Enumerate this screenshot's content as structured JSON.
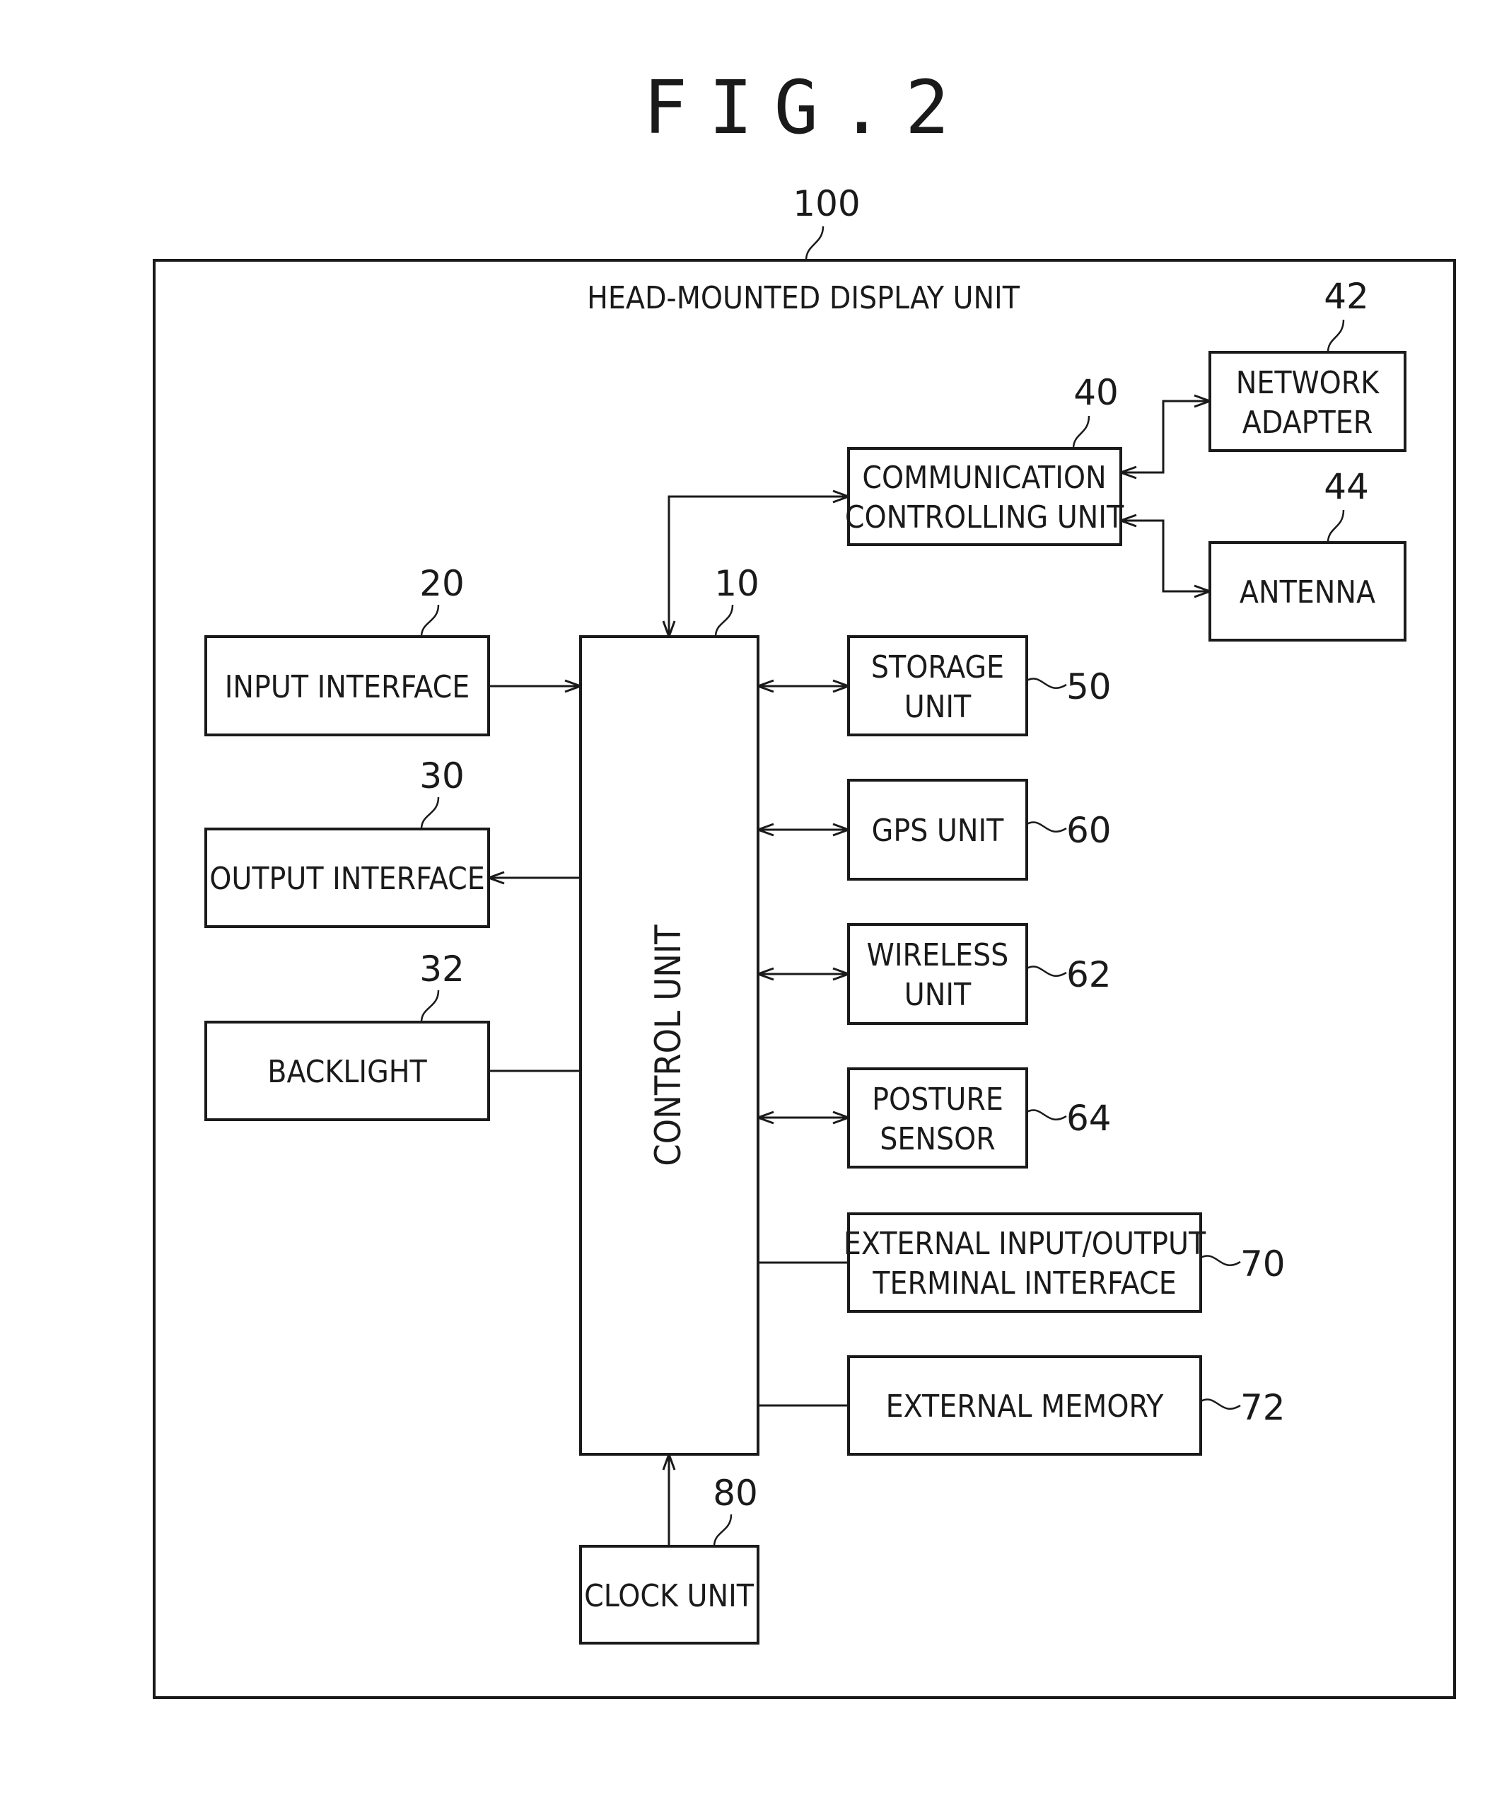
{
  "figure": {
    "title": "FIG.2",
    "system": {
      "ref": "100",
      "label": "HEAD-MOUNTED DISPLAY UNIT"
    }
  },
  "blocks": {
    "control_unit": {
      "ref": "10",
      "lines": [
        "CONTROL UNIT"
      ]
    },
    "input_interface": {
      "ref": "20",
      "lines": [
        "INPUT INTERFACE"
      ]
    },
    "output_interface": {
      "ref": "30",
      "lines": [
        "OUTPUT INTERFACE"
      ]
    },
    "backlight": {
      "ref": "32",
      "lines": [
        "BACKLIGHT"
      ]
    },
    "communication_controlling_unit": {
      "ref": "40",
      "lines": [
        "COMMUNICATION",
        "CONTROLLING UNIT"
      ]
    },
    "network_adapter": {
      "ref": "42",
      "lines": [
        "NETWORK",
        "ADAPTER"
      ]
    },
    "antenna": {
      "ref": "44",
      "lines": [
        "ANTENNA"
      ]
    },
    "storage_unit": {
      "ref": "50",
      "lines": [
        "STORAGE",
        "UNIT"
      ]
    },
    "gps_unit": {
      "ref": "60",
      "lines": [
        "GPS UNIT"
      ]
    },
    "wireless_unit": {
      "ref": "62",
      "lines": [
        "WIRELESS",
        "UNIT"
      ]
    },
    "posture_sensor": {
      "ref": "64",
      "lines": [
        "POSTURE",
        "SENSOR"
      ]
    },
    "external_io_terminal_interface": {
      "ref": "70",
      "lines": [
        "EXTERNAL INPUT/OUTPUT",
        "TERMINAL INTERFACE"
      ]
    },
    "external_memory": {
      "ref": "72",
      "lines": [
        "EXTERNAL MEMORY"
      ]
    },
    "clock_unit": {
      "ref": "80",
      "lines": [
        "CLOCK UNIT"
      ]
    }
  },
  "connections": [
    {
      "from": "input_interface",
      "to": "control_unit",
      "direction": "forward"
    },
    {
      "from": "control_unit",
      "to": "output_interface",
      "direction": "forward"
    },
    {
      "from": "backlight",
      "to": "control_unit",
      "direction": "none"
    },
    {
      "from": "control_unit",
      "to": "communication_controlling_unit",
      "direction": "both"
    },
    {
      "from": "communication_controlling_unit",
      "to": "network_adapter",
      "direction": "both"
    },
    {
      "from": "communication_controlling_unit",
      "to": "antenna",
      "direction": "both"
    },
    {
      "from": "control_unit",
      "to": "storage_unit",
      "direction": "both"
    },
    {
      "from": "control_unit",
      "to": "gps_unit",
      "direction": "both"
    },
    {
      "from": "control_unit",
      "to": "wireless_unit",
      "direction": "both"
    },
    {
      "from": "control_unit",
      "to": "posture_sensor",
      "direction": "both"
    },
    {
      "from": "control_unit",
      "to": "external_io_terminal_interface",
      "direction": "none"
    },
    {
      "from": "control_unit",
      "to": "external_memory",
      "direction": "none"
    },
    {
      "from": "clock_unit",
      "to": "control_unit",
      "direction": "forward"
    }
  ]
}
